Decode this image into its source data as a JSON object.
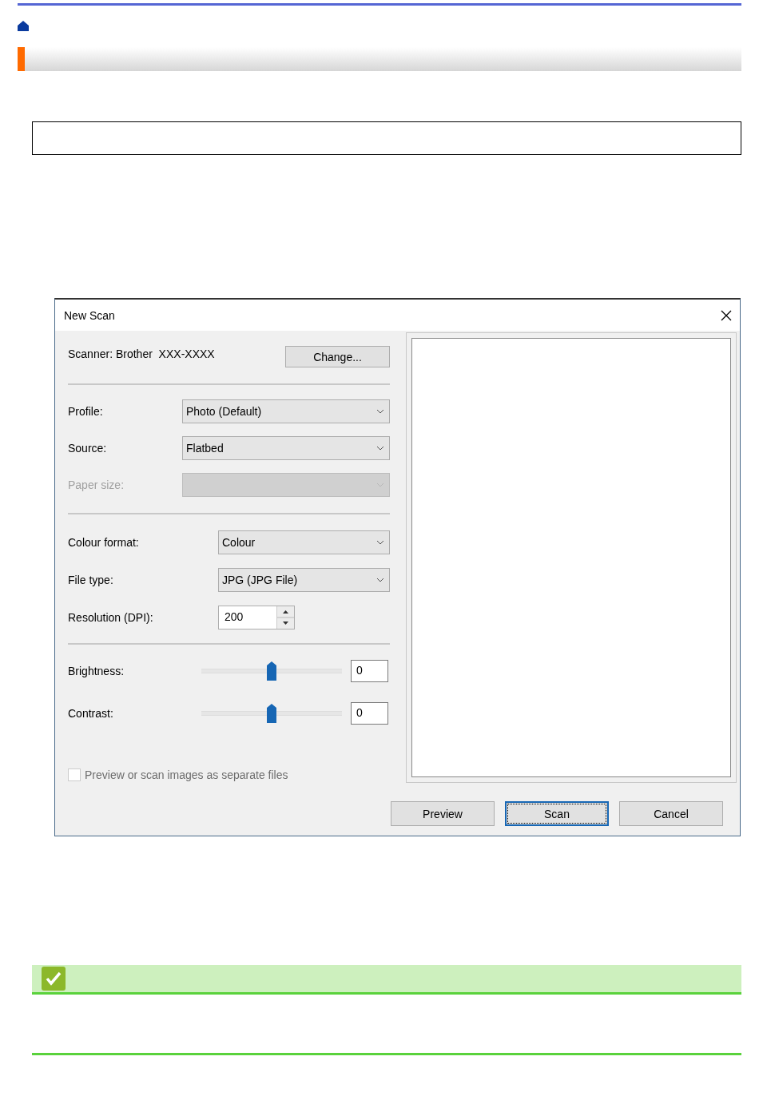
{
  "dialog": {
    "title": "New Scan",
    "scanner_label": "Scanner: Brother  XXX-XXXX",
    "change_button": "Change...",
    "groups": [
      {
        "fields": [
          {
            "kind": "dropdown",
            "label": "Profile:",
            "value": "Photo (Default)",
            "disabled": false
          },
          {
            "kind": "dropdown",
            "label": "Source:",
            "value": "Flatbed",
            "disabled": false
          },
          {
            "kind": "dropdown",
            "label": "Paper size:",
            "disabled": true
          }
        ]
      },
      {
        "fields": [
          {
            "kind": "dropdown",
            "label": "Colour format:",
            "value": "Colour",
            "disabled": false
          },
          {
            "kind": "dropdown",
            "label": "File type:",
            "value": "JPG (JPG File)",
            "disabled": false
          },
          {
            "kind": "spin",
            "label": "Resolution (DPI):",
            "value": "200",
            "disabled": false
          }
        ]
      }
    ],
    "sliders": [
      {
        "label": "Brightness:",
        "level": 0.5,
        "value": "0"
      },
      {
        "label": "Contrast:",
        "level": 0.5,
        "value": "0"
      }
    ],
    "checkbox": {
      "label": "Preview or scan images as separate files",
      "checked": false,
      "disabled": true
    },
    "buttons": [
      {
        "label": "Preview",
        "default": false
      },
      {
        "label": "Scan",
        "default": true
      },
      {
        "label": "Cancel",
        "default": false
      }
    ]
  }
}
